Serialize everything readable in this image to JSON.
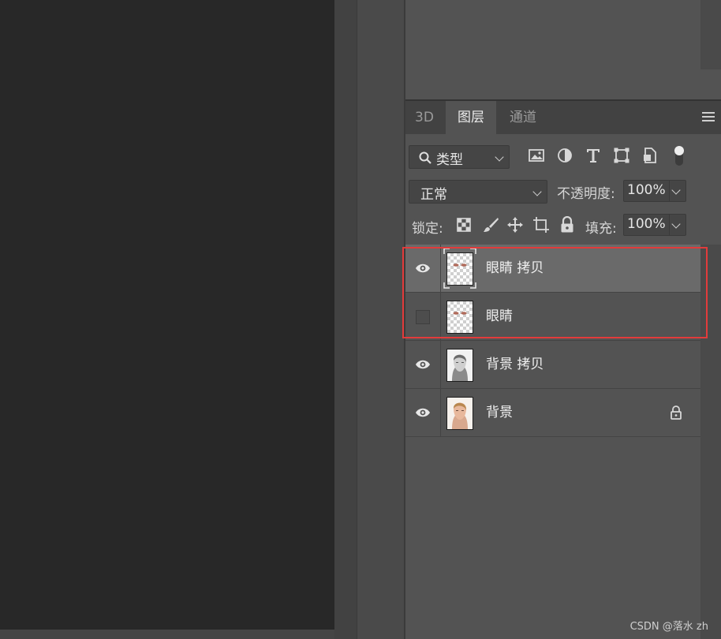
{
  "tabs": [
    {
      "label": "3D",
      "active": false
    },
    {
      "label": "图层",
      "active": true
    },
    {
      "label": "通道",
      "active": false
    }
  ],
  "filter": {
    "label": "类型"
  },
  "blend_mode": {
    "value": "正常"
  },
  "opacity": {
    "label": "不透明度:",
    "value": "100%"
  },
  "lock": {
    "label": "锁定:"
  },
  "fill": {
    "label": "填充:",
    "value": "100%"
  },
  "layers": [
    {
      "name": "眼睛 拷贝",
      "visible": true,
      "selected": true,
      "thumb": "eyes",
      "locked": false
    },
    {
      "name": "眼睛",
      "visible": false,
      "selected": false,
      "thumb": "eyes",
      "locked": false
    },
    {
      "name": "背景 拷贝",
      "visible": true,
      "selected": false,
      "thumb": "portrait-bw",
      "locked": false
    },
    {
      "name": "背景",
      "visible": true,
      "selected": false,
      "thumb": "portrait-color",
      "locked": true
    }
  ],
  "watermark": "CSDN @落水 zh",
  "colors": {
    "highlight": "#e23b3b",
    "panel": "#535353",
    "selected_row": "#6a6a6a"
  }
}
